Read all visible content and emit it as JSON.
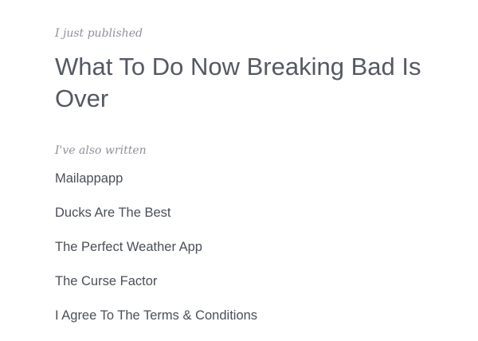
{
  "published": {
    "label": "I just published",
    "title": "What To Do Now Breaking Bad Is Over"
  },
  "also": {
    "label": "I've also written",
    "items": [
      "Mailappapp",
      "Ducks Are The Best",
      "The Perfect Weather App",
      "The Curse Factor",
      "I Agree To The Terms & Conditions"
    ]
  }
}
